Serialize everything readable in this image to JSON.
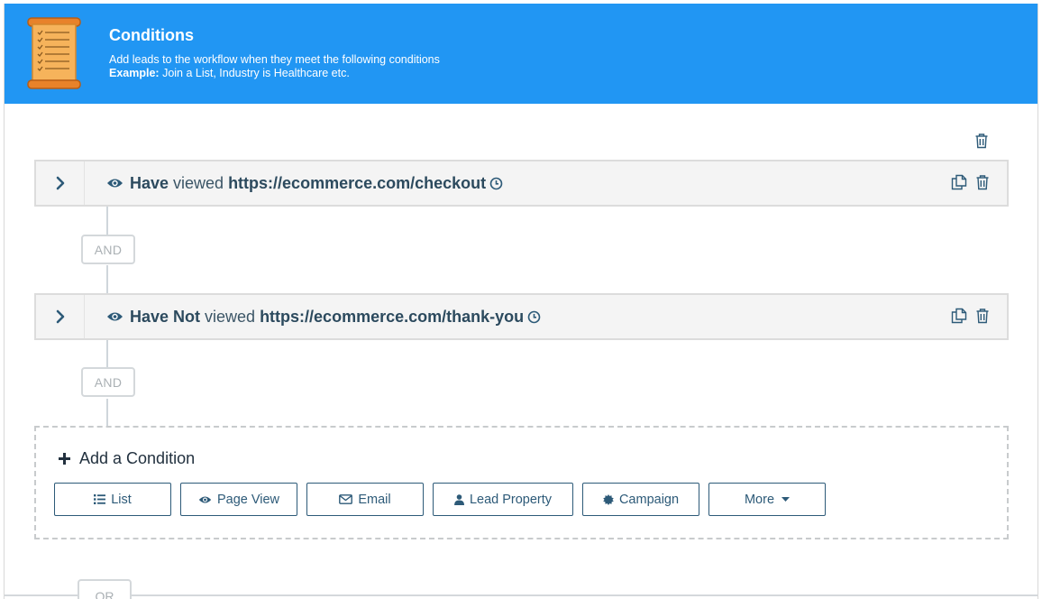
{
  "header": {
    "title": "Conditions",
    "description": "Add leads to the workflow when they meet the following conditions",
    "example_label": "Example:",
    "example_text": " Join a List, Industry is Healthcare etc.",
    "background_color": "#2196f3",
    "icon": "scroll-checklist-icon"
  },
  "conditions": [
    {
      "keyword": "Have",
      "verb": "viewed",
      "url": "https://ecommerce.com/checkout"
    },
    {
      "keyword": "Have Not",
      "verb": "viewed",
      "url": "https://ecommerce.com/thank-you"
    }
  ],
  "connectors": {
    "and_label": "AND",
    "or_label": "OR"
  },
  "add_condition": {
    "title": "Add a Condition",
    "buttons": {
      "list": "List",
      "page_view": "Page View",
      "email": "Email",
      "lead_property": "Lead Property",
      "campaign": "Campaign",
      "more": "More"
    }
  },
  "colors": {
    "accent": "#2196f3",
    "button_border": "#2d5a78",
    "row_background": "#f4f4f4"
  }
}
